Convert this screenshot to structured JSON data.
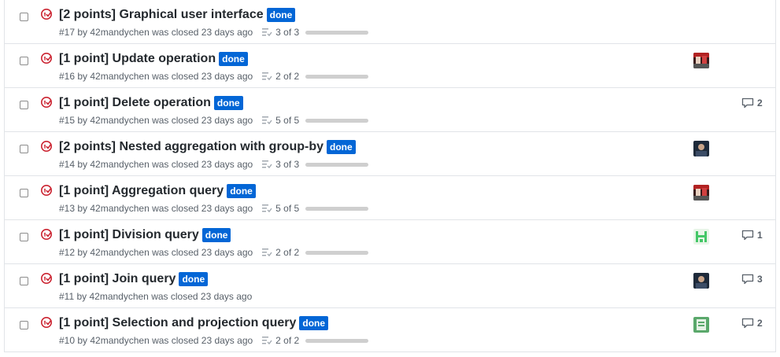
{
  "issues": [
    {
      "title": "[2 points] Graphical user interface",
      "label": "done",
      "meta": "#17 by 42mandychen was closed 23 days ago",
      "tasks": {
        "text": "3 of 3",
        "fraction": 1.0
      },
      "avatar": "none",
      "comments": ""
    },
    {
      "title": "[1 point] Update operation",
      "label": "done",
      "meta": "#16 by 42mandychen was closed 23 days ago",
      "tasks": {
        "text": "2 of 2",
        "fraction": 1.0
      },
      "avatar": "avatar-red",
      "comments": ""
    },
    {
      "title": "[1 point] Delete operation",
      "label": "done",
      "meta": "#15 by 42mandychen was closed 23 days ago",
      "tasks": {
        "text": "5 of 5",
        "fraction": 1.0
      },
      "avatar": "none",
      "comments": "2"
    },
    {
      "title": "[2 points] Nested aggregation with group-by",
      "label": "done",
      "meta": "#14 by 42mandychen was closed 23 days ago",
      "tasks": {
        "text": "3 of 3",
        "fraction": 1.0
      },
      "avatar": "avatar-dark",
      "comments": ""
    },
    {
      "title": "[1 point] Aggregation query",
      "label": "done",
      "meta": "#13 by 42mandychen was closed 23 days ago",
      "tasks": {
        "text": "5 of 5",
        "fraction": 1.0
      },
      "avatar": "avatar-red",
      "comments": ""
    },
    {
      "title": "[1 point] Division query",
      "label": "done",
      "meta": "#12 by 42mandychen was closed 23 days ago",
      "tasks": {
        "text": "2 of 2",
        "fraction": 1.0
      },
      "avatar": "avatar-green-identicon",
      "comments": "1"
    },
    {
      "title": "[1 point] Join query",
      "label": "done",
      "meta": "#11 by 42mandychen was closed 23 days ago",
      "tasks": null,
      "avatar": "avatar-dark",
      "comments": "3"
    },
    {
      "title": "[1 point] Selection and projection query",
      "label": "done",
      "meta": "#10 by 42mandychen was closed 23 days ago",
      "tasks": {
        "text": "2 of 2",
        "fraction": 1.0
      },
      "avatar": "avatar-green-box",
      "comments": "2"
    }
  ],
  "colors": {
    "closed_icon": "#cb2431",
    "label_bg": "#0366d6",
    "meta_text": "#586069",
    "border": "#e1e4e8"
  }
}
